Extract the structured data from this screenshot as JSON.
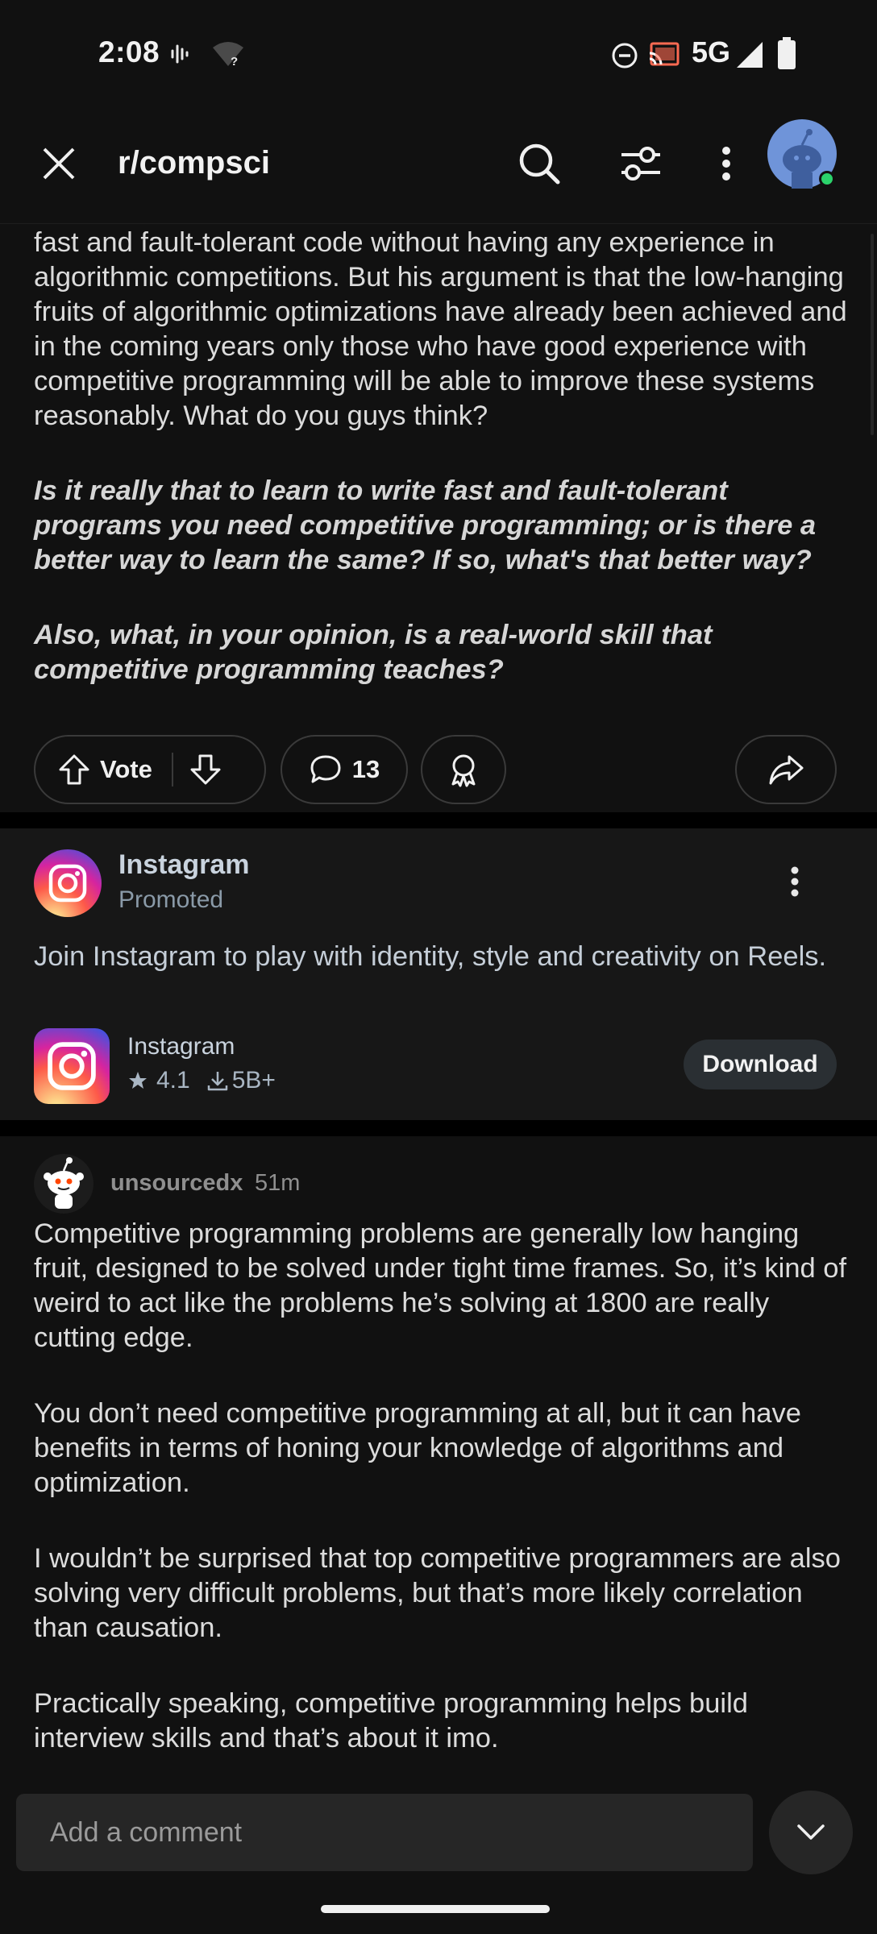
{
  "status_bar": {
    "time": "2:08",
    "network": "5G"
  },
  "header": {
    "title": "r/compsci"
  },
  "post": {
    "paragraphs": [
      "fast and fault-tolerant code without having any experience in algorithmic competitions. But his argument is that the low-hanging fruits of algorithmic optimizations have already been achieved and in the coming years only those who have good experience with competitive programming will be able to improve these systems reasonably. What do you guys think?"
    ],
    "italic_paragraphs": [
      "Is it really that to learn to write fast and fault-tolerant programs you need competitive programming; or is there a better way to learn the same? If so, what's that better way?",
      "Also, what, in your opinion, is a real-world skill that competitive programming teaches?"
    ],
    "vote_label": "Vote",
    "comment_count": "13"
  },
  "ad": {
    "advertiser": "Instagram",
    "promoted_label": "Promoted",
    "text": "Join Instagram to play with identity, style and creativity on Reels.",
    "app_name": "Instagram",
    "rating": "4.1",
    "downloads": "5B+",
    "cta": "Download"
  },
  "comment": {
    "username": "unsourcedx",
    "time": "51m",
    "paragraphs": [
      "Competitive programming problems are generally low hanging fruit, designed to be solved under tight time frames. So, it’s kind of weird to act like the problems he’s solving at 1800 are really cutting edge.",
      "You don’t need competitive programming at all, but it can have benefits in terms of honing your knowledge of algorithms and optimization.",
      "I wouldn’t be surprised that top competitive programmers are also solving very difficult problems, but that’s more likely correlation than causation.",
      "Practically speaking, competitive programming helps build interview skills and that’s about it imo."
    ]
  },
  "composer": {
    "placeholder": "Add a comment"
  },
  "icons": {
    "close": "close-icon",
    "search": "search-icon",
    "filter": "filter-icon",
    "more": "more-vert-icon",
    "upvote": "arrow-up-icon",
    "downvote": "arrow-down-icon",
    "comment": "comment-icon",
    "award": "award-icon",
    "share": "share-icon",
    "star": "star-icon",
    "download": "download-icon",
    "chevron": "chevron-down-icon"
  },
  "colors": {
    "background": "#111111",
    "ad_background": "#171717",
    "online": "#2bd36b",
    "avatar": "#6f94d9"
  }
}
